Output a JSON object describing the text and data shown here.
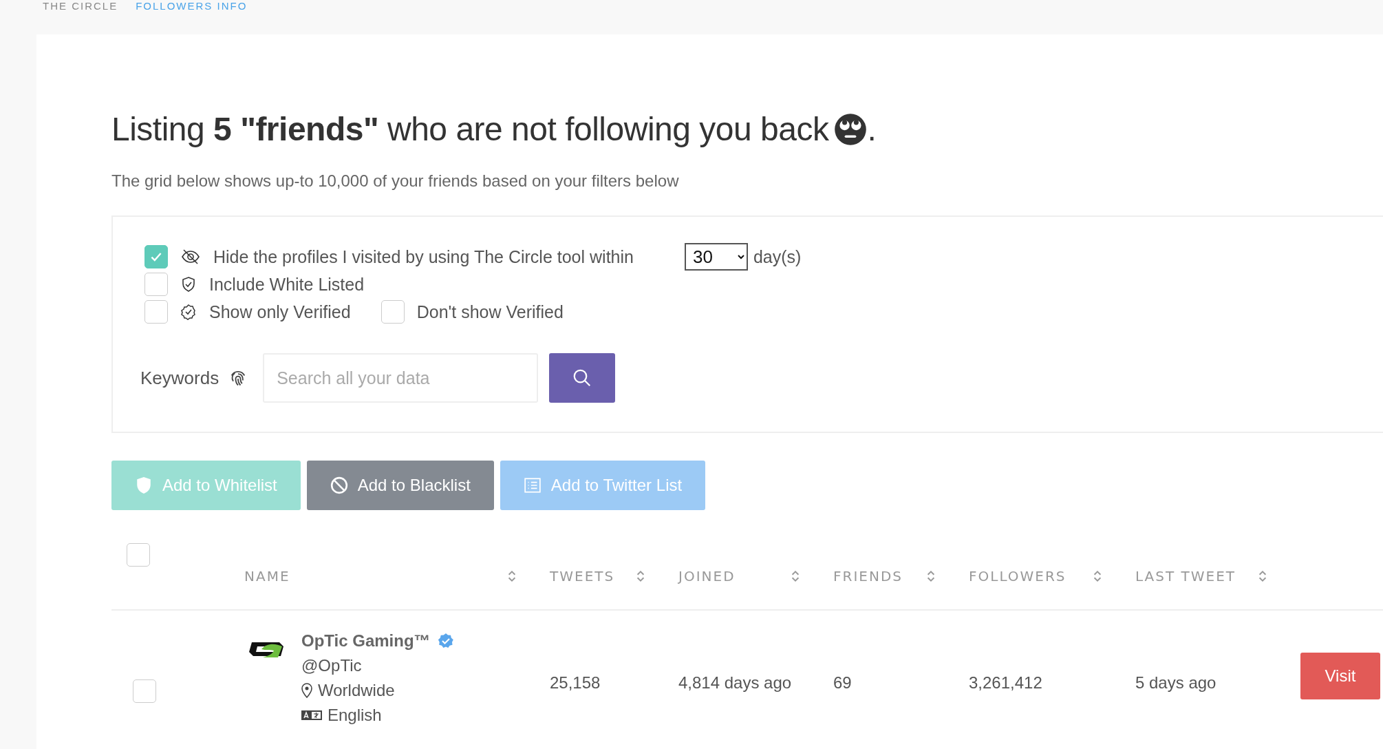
{
  "breadcrumb": [
    {
      "label": "THE CIRCLE"
    },
    {
      "label": "FOLLOWERS INFO"
    }
  ],
  "heading": {
    "text": "Listing **5 \"friends\"** who are not following you back",
    "end": "."
  },
  "subtitle": "The grid below shows up-to 10,000 of your friends based on your filters below",
  "filters": [
    {
      "label": "Hide the profiles I visited by using The Circle tool within",
      "checked": true
    },
    {
      "label": "Include White Listed",
      "checked": false
    },
    {
      "label": "Show only Verified",
      "checked": false
    },
    {
      "label": "Don't show Verified",
      "checked": false
    }
  ],
  "days_select": {
    "value": "30",
    "unit": "day(s)"
  },
  "keywords": {
    "label": "Keywords",
    "placeholder": "Search all your data"
  },
  "actions": [
    {
      "label": "Add to Whitelist",
      "color": "#9adfd3"
    },
    {
      "label": "Add to Blacklist",
      "color": "#848a92"
    },
    {
      "label": "Add to Twitter List",
      "color": "#9ccaf5"
    }
  ],
  "table": {
    "select_all": {
      "checked": false
    },
    "columns": [
      {
        "label": "NAME"
      },
      {
        "label": "TWEETS"
      },
      {
        "label": "JOINED"
      },
      {
        "label": "FRIENDS"
      },
      {
        "label": "FOLLOWERS"
      },
      {
        "label": "LAST TWEET"
      }
    ],
    "rows": [
      {
        "selected": false,
        "name": "OpTic Gaming™",
        "verified": true,
        "handle": "@OpTic",
        "location": "Worldwide",
        "language": "English",
        "tweets": "25,158",
        "joined": "4,814 days ago",
        "friends": "69",
        "followers": "3,261,412",
        "last_tweet": "5 days ago",
        "action": "Visit"
      }
    ]
  }
}
